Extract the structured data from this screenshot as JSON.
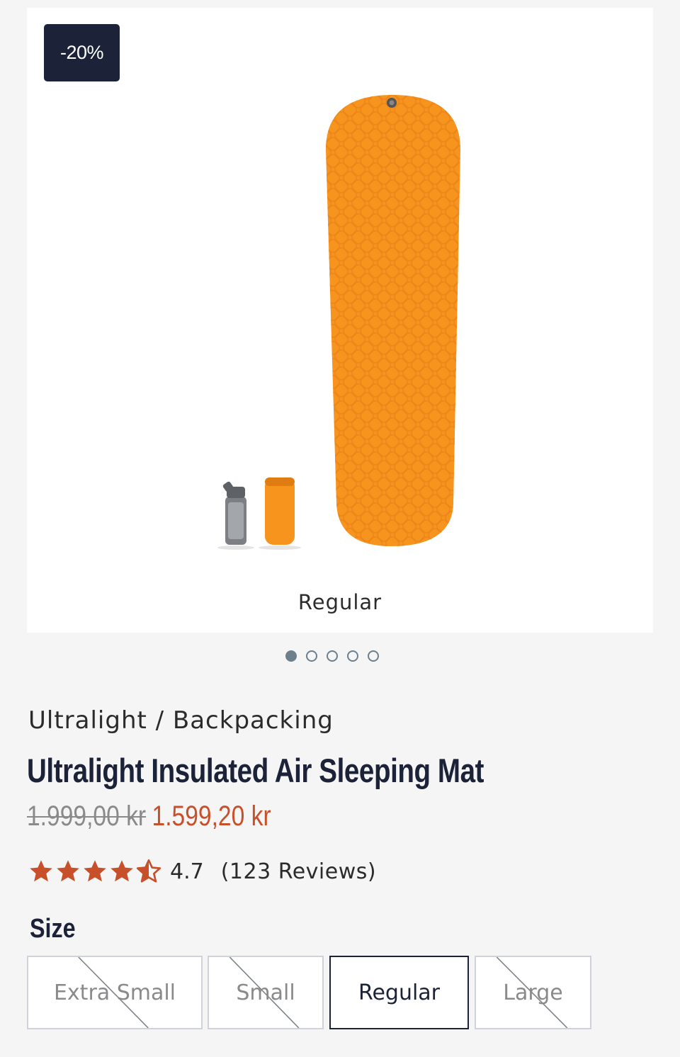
{
  "gallery": {
    "badge": "-20%",
    "caption": "Regular",
    "slides": 5,
    "active_slide": 1,
    "product_color": "#f7941d"
  },
  "product": {
    "category": "Ultralight / Backpacking",
    "title": "Ultralight Insulated Air Sleeping Mat",
    "old_price": "1.999,00 kr",
    "new_price": "1.599,20 kr",
    "rating": "4.7",
    "rating_stars": 4.5,
    "reviews": "(123 Reviews)"
  },
  "size": {
    "label": "Size",
    "options": [
      {
        "label": "Extra Small",
        "available": false
      },
      {
        "label": "Small",
        "available": false
      },
      {
        "label": "Regular",
        "available": true,
        "selected": true
      },
      {
        "label": "Large",
        "available": false
      }
    ]
  },
  "colors": {
    "accent": "#c7502b",
    "navy": "#1c2237",
    "star": "#c7502b"
  }
}
